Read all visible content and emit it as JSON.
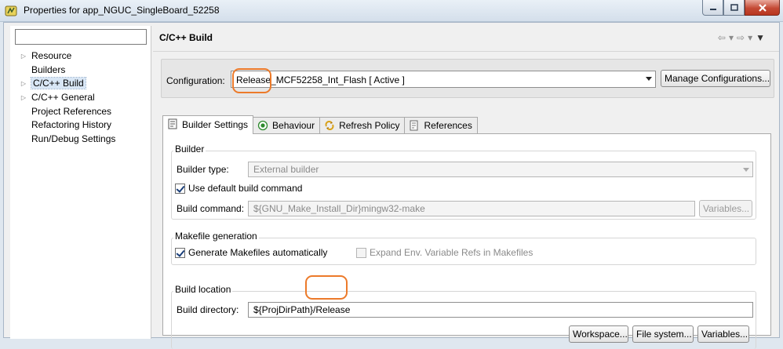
{
  "window": {
    "title": "Properties for app_NGUC_SingleBoard_52258",
    "controls": {
      "minimize": "minimize-icon",
      "maximize": "maximize-icon",
      "close": "close-icon"
    }
  },
  "sidebar": {
    "filter": {
      "value": "",
      "placeholder": ""
    },
    "items": [
      {
        "label": "Resource",
        "expandable": true
      },
      {
        "label": "Builders",
        "expandable": false
      },
      {
        "label": "C/C++ Build",
        "expandable": true,
        "selected": true
      },
      {
        "label": "C/C++ General",
        "expandable": true
      },
      {
        "label": "Project References",
        "expandable": false
      },
      {
        "label": "Refactoring History",
        "expandable": false
      },
      {
        "label": "Run/Debug Settings",
        "expandable": false
      }
    ]
  },
  "page": {
    "title": "C/C++ Build",
    "configuration": {
      "label": "Configuration:",
      "value": "Release_MCF52258_Int_Flash  [ Active ]",
      "manage_button": "Manage Configurations..."
    },
    "tabs": [
      {
        "label": "Builder Settings",
        "icon": "builder-settings-icon",
        "active": true
      },
      {
        "label": "Behaviour",
        "icon": "behaviour-icon",
        "active": false
      },
      {
        "label": "Refresh Policy",
        "icon": "refresh-policy-icon",
        "active": false
      },
      {
        "label": "References",
        "icon": "references-icon",
        "active": false
      }
    ],
    "builder": {
      "group_title": "Builder",
      "type_label": "Builder type:",
      "type_value": "External builder",
      "use_default_label": "Use default build command",
      "use_default_checked": true,
      "command_label": "Build command:",
      "command_value": "${GNU_Make_Install_Dir}mingw32-make",
      "variables_button": "Variables..."
    },
    "makefile": {
      "group_title": "Makefile generation",
      "generate_label": "Generate Makefiles automatically",
      "generate_checked": true,
      "expand_label": "Expand Env. Variable Refs in Makefiles",
      "expand_checked": false
    },
    "location": {
      "group_title": "Build location",
      "directory_label": "Build directory:",
      "directory_value": "${ProjDirPath}/Release",
      "workspace_button": "Workspace...",
      "filesystem_button": "File system...",
      "variables_button": "Variables..."
    }
  },
  "colors": {
    "highlight": "#ec7a2a",
    "selection": "#d8e6f5"
  }
}
